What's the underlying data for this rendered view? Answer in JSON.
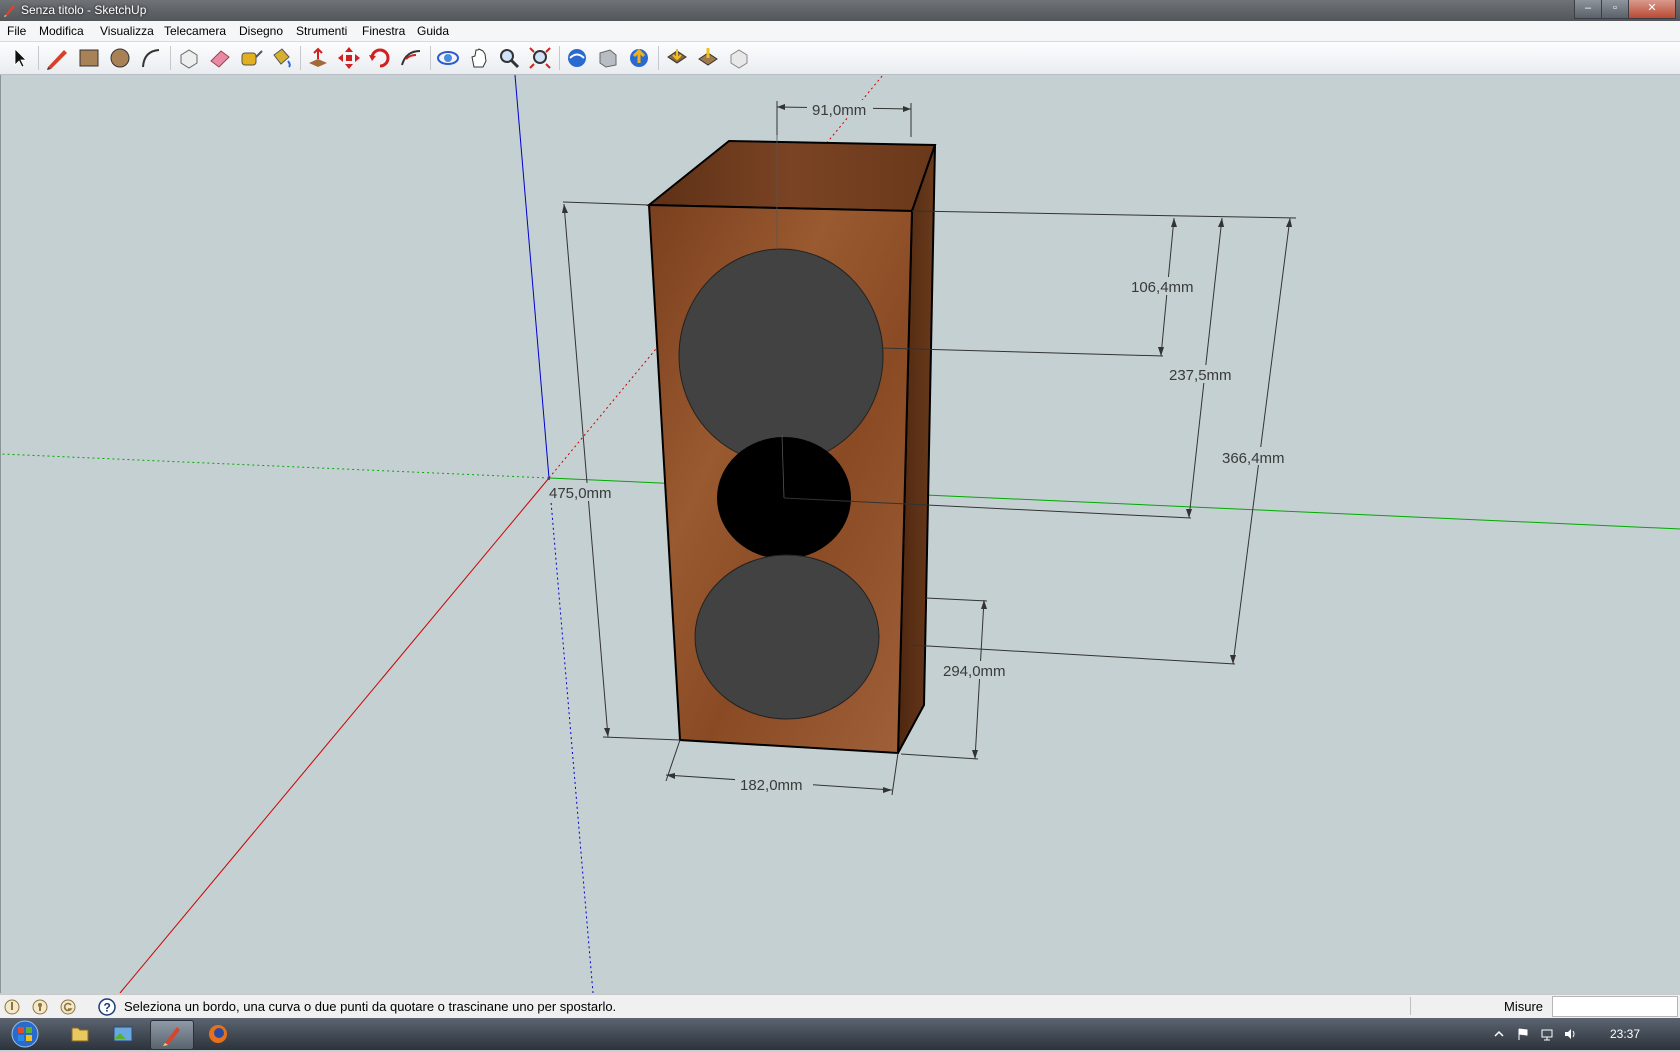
{
  "window": {
    "title": "Senza titolo - SketchUp"
  },
  "window_controls": {
    "minimize": "–",
    "maximize": "▫",
    "close": "✕"
  },
  "menu": [
    "File",
    "Modifica",
    "Visualizza",
    "Telecamera",
    "Disegno",
    "Strumenti",
    "Finestra",
    "Guida"
  ],
  "toolbar": {
    "tools": [
      "select",
      "pencil",
      "rectangle",
      "circle",
      "arc",
      "make-component",
      "eraser",
      "tape-measure",
      "paint-bucket",
      "push-pull",
      "move",
      "rotate",
      "follow-me",
      "orbit",
      "pan",
      "zoom",
      "zoom-extents",
      "get-models",
      "share-model",
      "component-warehouse",
      "add-location",
      "toggle-terrain",
      "photo-textures"
    ]
  },
  "model": {
    "dimensions": {
      "top_width": "91,0mm",
      "upper_offset": "106,4mm",
      "middle_offset": "237,5mm",
      "lower_offset": "366,4mm",
      "height": "475,0mm",
      "bottom_offset": "294,0mm",
      "bottom_width": "182,0mm"
    },
    "colors": {
      "wood_front": "#8a4a24",
      "wood_side": "#5a2e14",
      "wood_top": "#6a3a1c",
      "speaker_cutout": "#424242",
      "tweeter_hole": "#000000",
      "axis_red": "#cc0000",
      "axis_green": "#00aa00",
      "axis_blue": "#0000cc",
      "background": "#c4d0d2"
    }
  },
  "statusbar": {
    "message": "Seleziona un bordo, una curva o due punti da quotare o trascinane uno per spostarlo.",
    "measure_label": "Misure",
    "measure_value": ""
  },
  "taskbar": {
    "clock": "23:37"
  }
}
